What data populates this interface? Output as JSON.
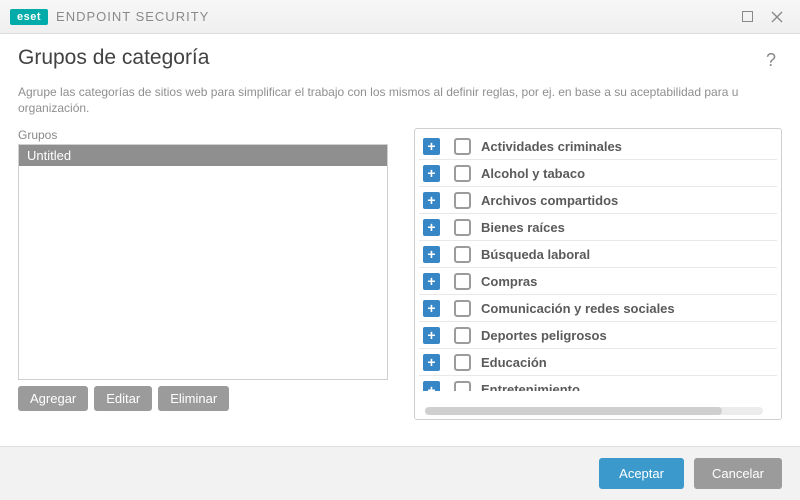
{
  "titlebar": {
    "brand_badge": "eset",
    "brand_name": "ENDPOINT SECURITY"
  },
  "page": {
    "title": "Grupos de categoría",
    "description": "Agrupe las categorías de sitios web para simplificar el trabajo con los mismos al definir reglas, por ej. en base a su aceptabilidad para u organización.",
    "groups_label": "Grupos"
  },
  "groups": {
    "items": [
      "Untitled"
    ]
  },
  "group_buttons": {
    "add": "Agregar",
    "edit": "Editar",
    "delete": "Eliminar"
  },
  "categories": [
    {
      "label": "Actividades criminales",
      "checked": false
    },
    {
      "label": "Alcohol y tabaco",
      "checked": false
    },
    {
      "label": "Archivos compartidos",
      "checked": false
    },
    {
      "label": "Bienes raíces",
      "checked": false
    },
    {
      "label": "Búsqueda laboral",
      "checked": false
    },
    {
      "label": "Compras",
      "checked": false
    },
    {
      "label": "Comunicación y redes sociales",
      "checked": false
    },
    {
      "label": "Deportes peligrosos",
      "checked": false
    },
    {
      "label": "Educación",
      "checked": false
    },
    {
      "label": "Entretenimiento",
      "checked": false
    }
  ],
  "footer": {
    "ok": "Aceptar",
    "cancel": "Cancelar"
  }
}
